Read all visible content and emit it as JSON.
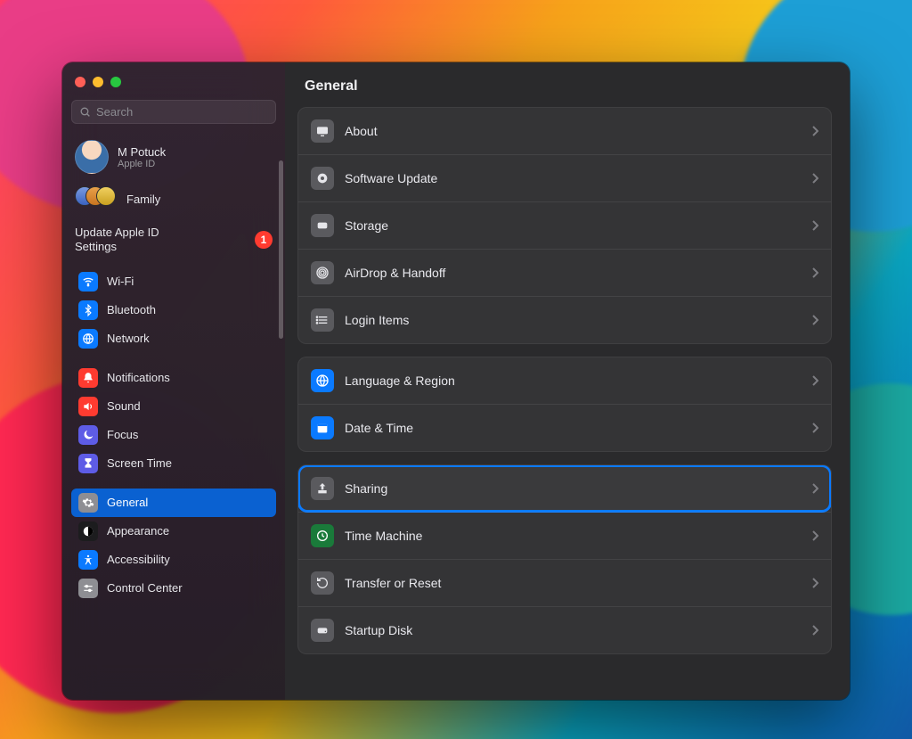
{
  "header": {
    "title": "General"
  },
  "search": {
    "placeholder": "Search"
  },
  "account": {
    "name": "M Potuck",
    "subtitle": "Apple ID"
  },
  "family": {
    "label": "Family"
  },
  "update": {
    "line1": "Update Apple ID",
    "line2": "Settings",
    "badge": "1"
  },
  "sidebar": {
    "group1": [
      {
        "label": "Wi-Fi"
      },
      {
        "label": "Bluetooth"
      },
      {
        "label": "Network"
      }
    ],
    "group2": [
      {
        "label": "Notifications"
      },
      {
        "label": "Sound"
      },
      {
        "label": "Focus"
      },
      {
        "label": "Screen Time"
      }
    ],
    "group3": [
      {
        "label": "General"
      },
      {
        "label": "Appearance"
      },
      {
        "label": "Accessibility"
      },
      {
        "label": "Control Center"
      }
    ]
  },
  "main": {
    "group1": [
      {
        "label": "About"
      },
      {
        "label": "Software Update"
      },
      {
        "label": "Storage"
      },
      {
        "label": "AirDrop & Handoff"
      },
      {
        "label": "Login Items"
      }
    ],
    "group2": [
      {
        "label": "Language & Region"
      },
      {
        "label": "Date & Time"
      }
    ],
    "group3": [
      {
        "label": "Sharing"
      },
      {
        "label": "Time Machine"
      },
      {
        "label": "Transfer or Reset"
      },
      {
        "label": "Startup Disk"
      }
    ]
  }
}
